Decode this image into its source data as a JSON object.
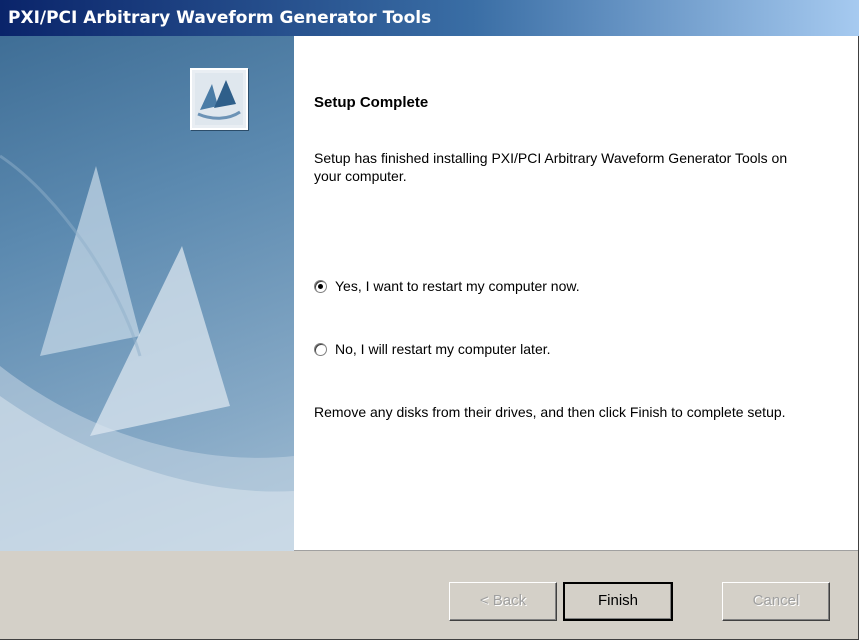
{
  "window": {
    "title": "PXI/PCI Arbitrary Waveform Generator Tools"
  },
  "content": {
    "heading": "Setup Complete",
    "intro": "Setup has finished installing PXI/PCI Arbitrary Waveform Generator Tools on your computer.",
    "options": [
      {
        "label": "Yes, I want to restart my computer now.",
        "selected": true
      },
      {
        "label": "No, I will restart my computer later.",
        "selected": false
      }
    ],
    "instructions": "Remove any disks from their drives, and then click Finish to complete setup."
  },
  "buttons": {
    "back": {
      "label": "< Back",
      "enabled": false
    },
    "finish": {
      "label": "Finish",
      "enabled": true
    },
    "cancel": {
      "label": "Cancel",
      "enabled": false
    }
  },
  "icons": {
    "logo": "installer-logo-icon",
    "radio": "radio-button"
  }
}
